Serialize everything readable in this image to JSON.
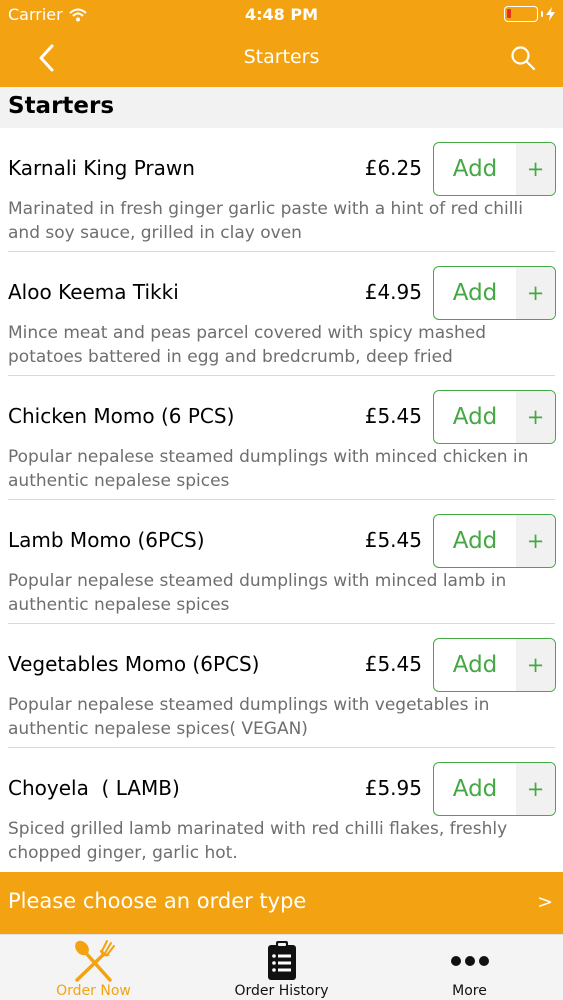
{
  "status_bar": {
    "carrier": "Carrier",
    "time": "4:48 PM",
    "battery_level": 0.15
  },
  "nav": {
    "title": "Starters",
    "back_icon": "chevron-left-icon",
    "search_icon": "search-icon"
  },
  "section": {
    "title": "Starters"
  },
  "items": [
    {
      "name": "Karnali King Prawn",
      "price": "£6.25",
      "description": "Marinated in fresh ginger garlic paste with a hint of red chilli and soy sauce, grilled in clay oven",
      "add_label": "Add",
      "plus_label": "+"
    },
    {
      "name": "Aloo Keema Tikki",
      "price": "£4.95",
      "description": "Mince meat and peas parcel covered with spicy mashed potatoes battered in egg and bredcrumb, deep fried",
      "add_label": "Add",
      "plus_label": "+"
    },
    {
      "name": "Chicken Momo (6 PCS)",
      "price": "£5.45",
      "description": "Popular nepalese steamed dumplings with minced chicken in authentic nepalese spices",
      "add_label": "Add",
      "plus_label": "+"
    },
    {
      "name": "Lamb Momo (6PCS)",
      "price": "£5.45",
      "description": "Popular nepalese steamed dumplings with minced lamb in authentic nepalese spices",
      "add_label": "Add",
      "plus_label": "+"
    },
    {
      "name": "Vegetables Momo (6PCS)",
      "price": "£5.45",
      "description": "Popular nepalese steamed dumplings with vegetables in authentic nepalese spices( VEGAN)",
      "add_label": "Add",
      "plus_label": "+"
    },
    {
      "name": "Choyela  ( LAMB)",
      "price": "£5.95",
      "description": "Spiced grilled lamb marinated with red chilli flakes, freshly chopped ginger, garlic hot.",
      "add_label": "Add",
      "plus_label": "+"
    }
  ],
  "order_bar": {
    "text": "Please choose an order type",
    "arrow": ">"
  },
  "tabbar": {
    "tabs": [
      {
        "label": "Order Now",
        "icon": "fork-spoon-icon",
        "active": true
      },
      {
        "label": "Order History",
        "icon": "clipboard-list-icon",
        "active": false
      },
      {
        "label": "More",
        "icon": "more-dots-icon",
        "active": false
      }
    ]
  },
  "colors": {
    "brand": "#F3A312",
    "accent_green": "#44A944",
    "battery_low": "#E5311B",
    "description_text": "#6E6E6E"
  }
}
